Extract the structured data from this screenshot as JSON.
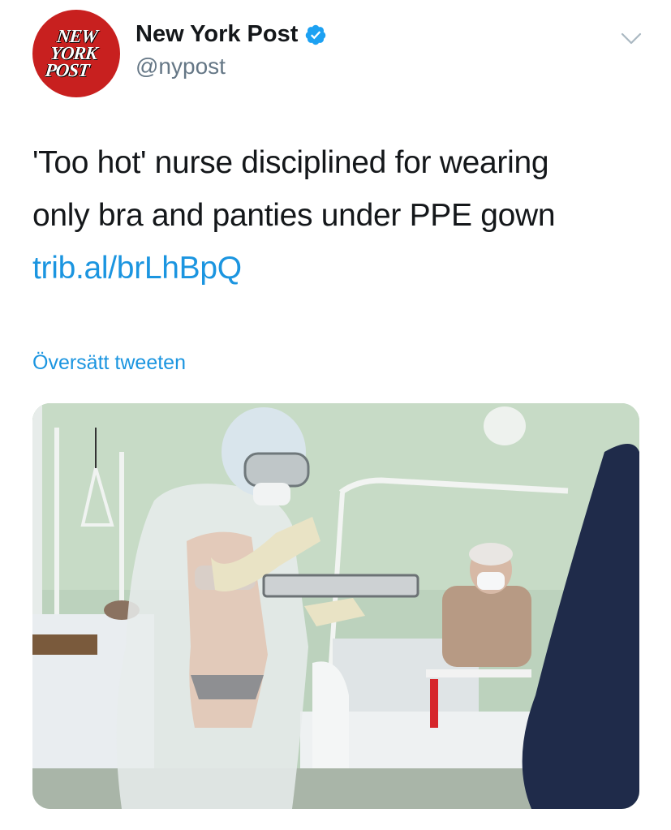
{
  "account": {
    "logo_text": [
      "NEW",
      "YORK",
      "POST"
    ],
    "name": "New York Post",
    "handle": "@nypost",
    "verified": true,
    "verified_icon": "verified-badge-icon",
    "menu_icon": "chevron-down-icon"
  },
  "tweet": {
    "line1": "'Too hot' nurse disciplined for wearing",
    "line2": "only bra and panties under PPE gown",
    "link": "trib.al/brLhBpQ"
  },
  "translate_label": "Översätt tweeten",
  "media": {
    "description_icon": "photo-hospital-ward"
  },
  "colors": {
    "brand_red": "#c8201f",
    "link_blue": "#1b95e0",
    "text_primary": "#14171a",
    "text_secondary": "#657786"
  }
}
